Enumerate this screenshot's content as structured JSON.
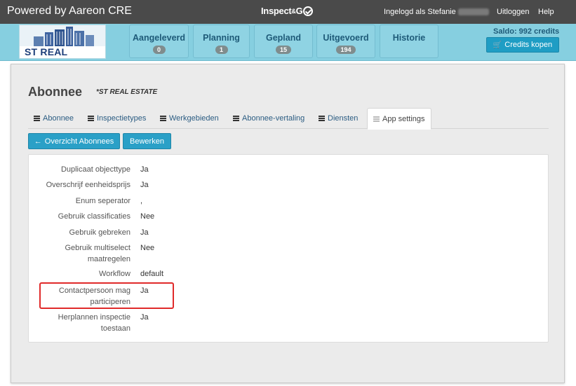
{
  "topbar": {
    "brand": "Powered by Aareon CRE",
    "app_logo_pre": "Inspect",
    "app_logo_amp": "&",
    "app_logo_post": "G",
    "logged_in_label": "Ingelogd als Stefanie",
    "logout": "Uitloggen",
    "help": "Help"
  },
  "company_logo": {
    "text": "ST REAL ESTATE"
  },
  "nav": {
    "tabs": [
      {
        "label": "Aangeleverd",
        "count": "0"
      },
      {
        "label": "Planning",
        "count": "1"
      },
      {
        "label": "Gepland",
        "count": "15"
      },
      {
        "label": "Uitgevoerd",
        "count": "194"
      },
      {
        "label": "Historie",
        "count": ""
      }
    ],
    "saldo": "Saldo: 992 credits",
    "credits_button": "Credits kopen"
  },
  "page": {
    "title": "Abonnee",
    "subtitle": "*ST REAL ESTATE",
    "tabs": [
      {
        "label": "Abonnee"
      },
      {
        "label": "Inspectietypes"
      },
      {
        "label": "Werkgebieden"
      },
      {
        "label": "Abonnee-vertaling"
      },
      {
        "label": "Diensten"
      },
      {
        "label": "App settings"
      }
    ],
    "active_tab": "App settings",
    "buttons": {
      "overview": "Overzicht Abonnees",
      "edit": "Bewerken"
    },
    "settings": [
      {
        "key_lines": [
          "Duplicaat objecttype"
        ],
        "value": "Ja"
      },
      {
        "key_lines": [
          "Overschrijf eenheidsprijs"
        ],
        "value": "Ja"
      },
      {
        "key_lines": [
          "Enum seperator"
        ],
        "value": ","
      },
      {
        "key_lines": [
          "Gebruik classificaties"
        ],
        "value": "Nee"
      },
      {
        "key_lines": [
          "Gebruik gebreken"
        ],
        "value": "Ja"
      },
      {
        "key_lines": [
          "Gebruik multiselect",
          "maatregelen"
        ],
        "value": "Nee"
      },
      {
        "key_lines": [
          "Workflow"
        ],
        "value": "default"
      },
      {
        "key_lines": [
          "Contactpersoon mag",
          "participeren"
        ],
        "value": "Ja"
      },
      {
        "key_lines": [
          "Herplannen inspectie",
          "toestaan"
        ],
        "value": "Ja"
      }
    ]
  },
  "colors": {
    "topbar": "#4a4a4a",
    "nav_band": "#86cfe0",
    "primary_button": "#2aa0c7",
    "highlight": "#e02a2a"
  }
}
